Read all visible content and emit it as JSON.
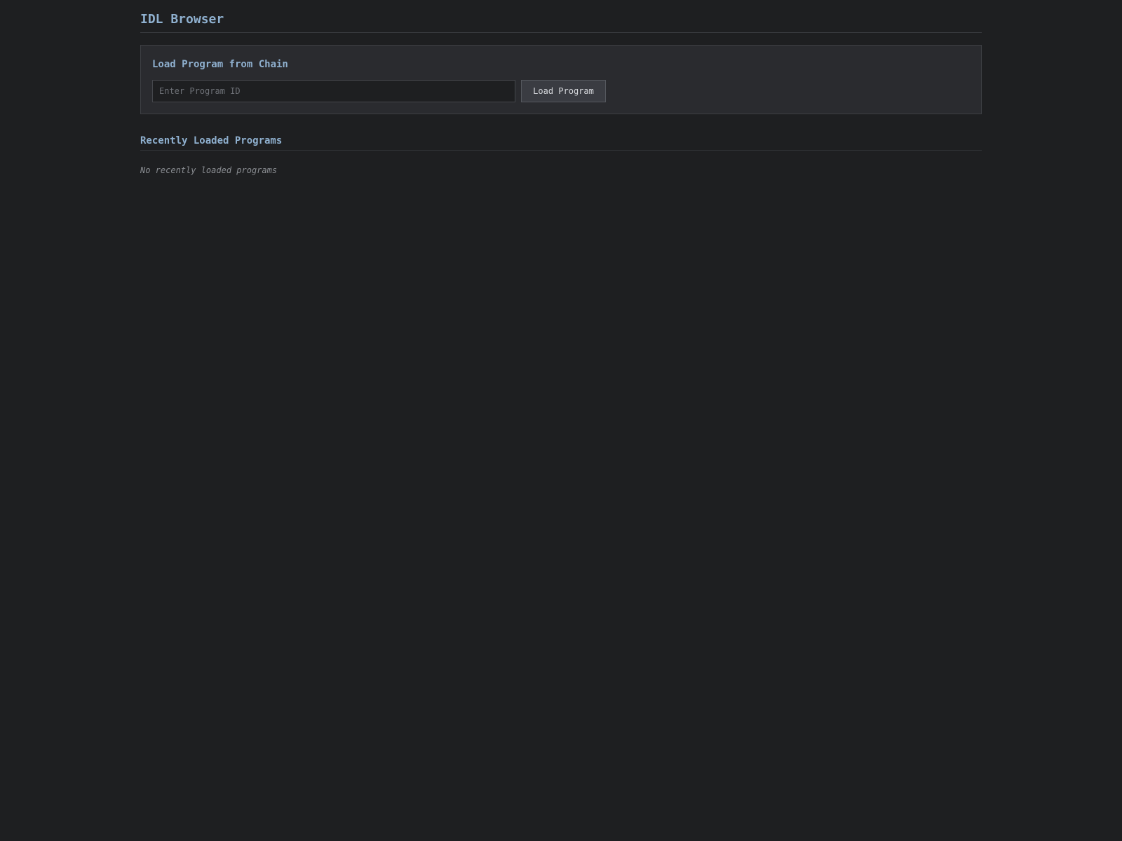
{
  "header": {
    "title": "IDL Browser"
  },
  "load_panel": {
    "title": "Load Program from Chain",
    "input": {
      "value": "",
      "placeholder": "Enter Program ID"
    },
    "button_label": "Load Program"
  },
  "recent": {
    "title": "Recently Loaded Programs",
    "empty_message": "No recently loaded programs",
    "items": []
  },
  "colors": {
    "background": "#1e1f21",
    "panel": "#2a2b2f",
    "accent": "#8fb0cf"
  }
}
